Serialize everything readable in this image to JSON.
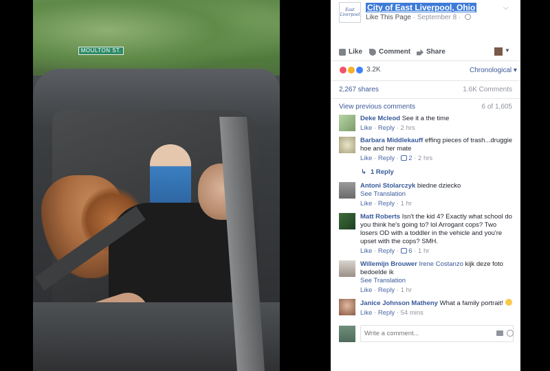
{
  "post": {
    "page_name": "City of East Liverpool, Ohio",
    "logo_text": "East Liverpool",
    "like_page": "Like This Page",
    "separator": "·",
    "date": "September 8",
    "sign_text": "MOULTON ST."
  },
  "actions": {
    "like": "Like",
    "comment": "Comment",
    "share": "Share"
  },
  "reactions": {
    "count": "3.2K",
    "sort": "Chronological",
    "colors": [
      "#f25268",
      "#f7b125",
      "#4080ff"
    ]
  },
  "stats": {
    "shares": "2,267 shares",
    "comments": "1.6K Comments"
  },
  "view_previous": "View previous comments",
  "of_count": "6 of 1,605",
  "comments": [
    {
      "name": "Deke Mcleod",
      "text": "See it a the time",
      "like": "Like",
      "reply": "Reply",
      "time": "2 hrs",
      "likes": ""
    },
    {
      "name": "Barbara Middlekauff",
      "text": "effing pieces of trash...druggie hoe and her mate",
      "like": "Like",
      "reply": "Reply",
      "time": "2 hrs",
      "likes": "2",
      "replies": "1 Reply"
    },
    {
      "name": "Antoni Stolarczyk",
      "text": "biedne dziecko",
      "see_translation": "See Translation",
      "like": "Like",
      "reply": "Reply",
      "time": "1 hr"
    },
    {
      "name": "Matt Roberts",
      "text": "Isn't the kid 4? Exactly what school do you think he's going to? lol Arrogant cops? Two losers OD with a toddler in the vehicle and you're upset with the cops? SMH.",
      "like": "Like",
      "reply": "Reply",
      "time": "1 hr",
      "likes": "6"
    },
    {
      "name": "Willemijn Brouwer",
      "mention": "Irene Costanzo",
      "text": "kijk deze foto bedoelde ik",
      "see_translation": "See Translation",
      "like": "Like",
      "reply": "Reply",
      "time": "1 hr"
    },
    {
      "name": "Janice Johnson Matheny",
      "text": "What a family portrait!",
      "like": "Like",
      "reply": "Reply",
      "time": "54 mins"
    }
  ],
  "write_comment": {
    "placeholder": "Write a comment..."
  }
}
